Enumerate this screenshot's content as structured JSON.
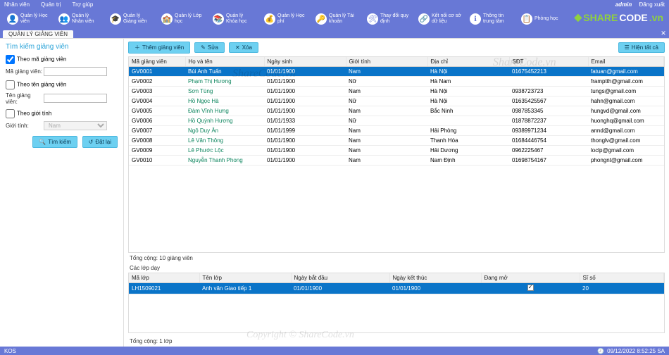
{
  "topmenu": {
    "left": [
      "Nhân viên",
      "Quản trị",
      "Trợ giúp"
    ],
    "user": "admin",
    "logout": "Đăng xuất"
  },
  "ribbon": [
    {
      "label": "Quản lý\nHọc viên",
      "icon": "👤"
    },
    {
      "label": "Quản lý\nNhân viên",
      "icon": "👥"
    },
    {
      "label": "Quản lý\nGiảng viên",
      "icon": "🎓"
    },
    {
      "label": "Quản lý\nLớp học",
      "icon": "🏫"
    },
    {
      "label": "Quản lý\nKhóa học",
      "icon": "📚"
    },
    {
      "label": "Quản lý\nHọc phí",
      "icon": "💰"
    },
    {
      "label": "Quản lý\nTài khoản",
      "icon": "🔑"
    },
    {
      "label": "Thay đổi\nquy định",
      "icon": "🛠"
    },
    {
      "label": "Kết nối cơ sở\ndữ liệu",
      "icon": "🔗"
    },
    {
      "label": "Thông tin\ntrung tâm",
      "icon": "ℹ"
    },
    {
      "label": "Phòng\nhọc",
      "icon": "📋"
    }
  ],
  "brand": {
    "s1": "SHARE",
    "s2": "CODE",
    "s3": ".vn"
  },
  "tabstrip": {
    "tab": "QUẢN LÝ GIẢNG VIÊN"
  },
  "sidebar": {
    "heading": "Tìm kiếm giảng viên",
    "cb_ma": "Theo mã giảng viên",
    "lbl_ma": "Mã giảng viên:",
    "val_ma": "",
    "cb_ten": "Theo tên giảng viên",
    "lbl_ten": "Tên giảng viên:",
    "val_ten": "",
    "cb_gt": "Theo giới tính",
    "lbl_gt": "Giới tính:",
    "val_gt": "Nam",
    "btn_search": "Tìm kiếm",
    "btn_reset": "Đặt lại"
  },
  "toolbar": {
    "add": "Thêm giảng viên",
    "edit": "Sửa",
    "del": "Xóa",
    "showall": "Hiện tất cả"
  },
  "grid1": {
    "cols": [
      "Mã giảng viên",
      "Họ và tên",
      "Ngày sinh",
      "Giới tính",
      "Địa chỉ",
      "SĐT",
      "Email"
    ],
    "widths": [
      "80",
      "112",
      "116",
      "116",
      "116",
      "112",
      "auto"
    ],
    "rows": [
      {
        "sel": true,
        "c": [
          "GV0001",
          "Bùi Anh Tuấn",
          "01/01/1900",
          "Nam",
          "Hà Nội",
          "01675452213",
          "fatuan@gmail.com"
        ]
      },
      {
        "c": [
          "GV0002",
          "Phạm Thị Hương",
          "01/01/1900",
          "Nữ",
          "Hà Nam",
          "",
          "framptth@gmail.com"
        ]
      },
      {
        "c": [
          "GV0003",
          "Sơn Tùng",
          "01/01/1900",
          "Nam",
          "Hà Nội",
          "0938723723",
          "tungs@gmail.com"
        ]
      },
      {
        "c": [
          "GV0004",
          "Hồ Ngọc Hà",
          "01/01/1900",
          "Nữ",
          "Hà Nội",
          "01635425567",
          "hahn@gmail.com"
        ]
      },
      {
        "c": [
          "GV0005",
          "Đàm Vĩnh Hưng",
          "01/01/1900",
          "Nam",
          "Bắc Ninh",
          "0987853345",
          "hungvd@gmail.com"
        ]
      },
      {
        "c": [
          "GV0006",
          "Hồ Quỳnh Hương",
          "01/01/1933",
          "Nữ",
          "",
          "01878872237",
          "huonghq@gmail.com"
        ]
      },
      {
        "c": [
          "GV0007",
          "Ngô Duy Ân",
          "01/01/1999",
          "Nam",
          "Hải Phòng",
          "09389971234",
          "annd@gmail.com"
        ]
      },
      {
        "c": [
          "GV0008",
          "Lê Văn Thông",
          "01/01/1900",
          "Nam",
          "Thanh Hóa",
          "01684446754",
          "thonglv@gmail.com"
        ]
      },
      {
        "c": [
          "GV0009",
          "Lê Phước Lộc",
          "01/01/1900",
          "Nam",
          "Hải Dương",
          "0962225467",
          "loclp@gmail.com"
        ]
      },
      {
        "c": [
          "GV0010",
          "Nguyễn Thanh Phong",
          "01/01/1900",
          "Nam",
          "Nam Định",
          "01698754167",
          "phongnt@gmail.com"
        ]
      }
    ],
    "total": "Tổng cộng: 10 giảng viên"
  },
  "subhead": "Các lớp dạy",
  "grid2": {
    "cols": [
      "Mã lớp",
      "Tên lớp",
      "Ngày bắt đầu",
      "Ngày kết thúc",
      "Đang mở",
      "Sĩ số"
    ],
    "widths": [
      "100",
      "130",
      "140",
      "130",
      "140",
      "auto"
    ],
    "rows": [
      {
        "sel": true,
        "c": [
          "LH1509021",
          "Anh văn Giao tiếp 1",
          "01/01/1900",
          "01/01/1900",
          "[check]",
          "20"
        ]
      }
    ],
    "total": "Tổng cộng: 1 lớp"
  },
  "status": {
    "left": "KOS",
    "right": "09/12/2022 8:52:25 SA"
  },
  "watermarks": [
    "ShareCode.vn",
    "ShareCode.vn",
    "Copyright © ShareCode.vn"
  ]
}
